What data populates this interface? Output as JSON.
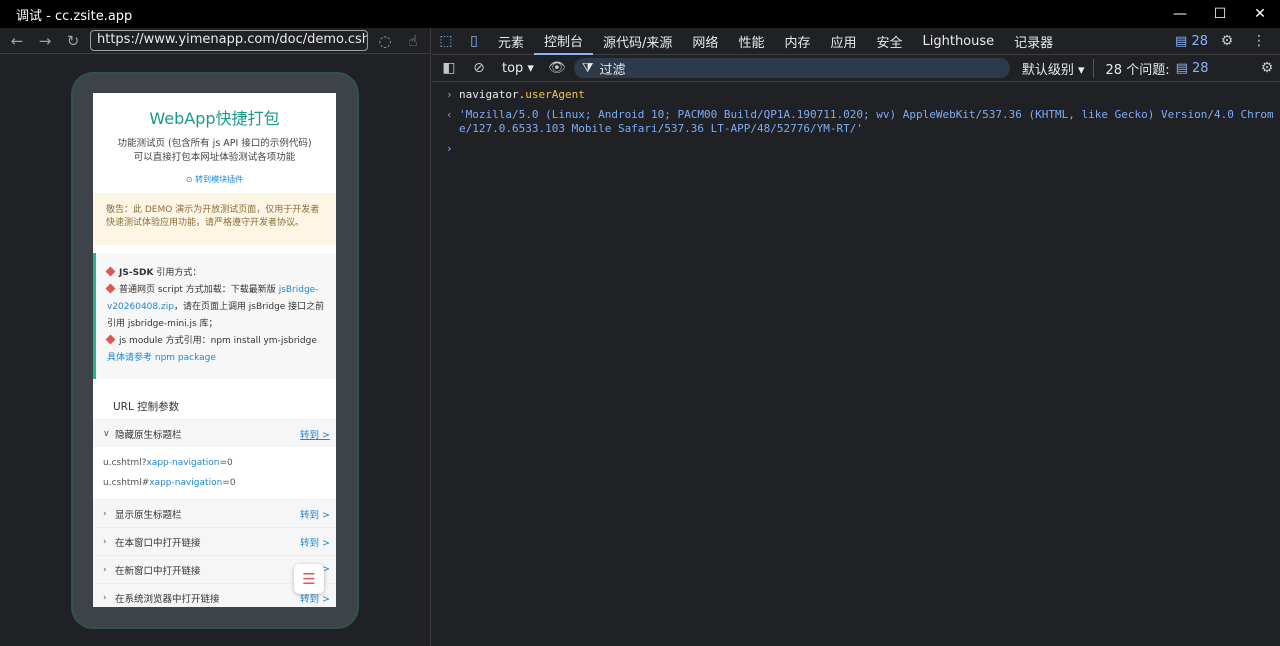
{
  "window": {
    "title": "调试 - cc.zsite.app",
    "minimize": "—",
    "maximize": "☐",
    "close": "✕"
  },
  "address": {
    "url": "https://www.yimenapp.com/doc/demo.cshtml"
  },
  "app": {
    "title": "WebApp快捷打包",
    "subtitle_1": "功能测试页 (包含所有 js API 接口的示例代码)",
    "subtitle_2": "可以直接打包本网址体验测试各项功能",
    "plugin_link": "转到模块插件",
    "warning": "敬告：此 DEMO 演示为开放测试页面，仅用于开发者快速测试体验应用功能，请严格遵守开发者协议。",
    "sdk": {
      "line1_bold": "JS-SDK",
      "line1_rest": "引用方式：",
      "line2_a": "普通网页 script 方式加载：下载最新版",
      "line2_link": "jsBridge-v20260408.zip",
      "line2_b": "，请在页面上调用 jsBridge 接口之前引用 jsbridge-mini.js 库；",
      "line3_a": "js module 方式引用：npm install ym-jsbridge",
      "line3_link": "具体请参考 npm package"
    },
    "section_title": "URL 控制参数",
    "accordion": [
      {
        "label": "隐藏原生标题栏",
        "go": "转到 >",
        "expanded": true,
        "body1_a": "u.cshtml?",
        "body1_hl": "xapp-navigation",
        "body1_b": "=0",
        "body2_a": "u.cshtml#",
        "body2_hl": "xapp-navigation",
        "body2_b": "=0"
      },
      {
        "label": "显示原生标题栏",
        "go": "转到 >"
      },
      {
        "label": "在本窗口中打开链接",
        "go": "转到 >"
      },
      {
        "label": "在新窗口中打开链接",
        "go": ">"
      },
      {
        "label": "在系统浏览器中打开链接",
        "go": "转到 >"
      }
    ]
  },
  "devtools": {
    "tabs": [
      "元素",
      "控制台",
      "源代码/来源",
      "网络",
      "性能",
      "内存",
      "应用",
      "安全",
      "Lighthouse",
      "记录器"
    ],
    "active_tab": "控制台",
    "issues_badge": "28",
    "context": "top",
    "filter_placeholder": "过滤",
    "levels": "默认级别 ▾",
    "issues_label": "28 个问题:",
    "issues_count": "28",
    "console": {
      "input_obj": "navigator.",
      "input_prop": "userAgent",
      "output": "'Mozilla/5.0 (Linux; Android 10; PACM00 Build/QP1A.190711.020; wv) AppleWebKit/537.36 (KHTML, like Gecko) Version/4.0 Chrome/127.0.6533.103 Mobile Safari/537.36 LT-APP/48/52776/YM-RT/'"
    }
  }
}
